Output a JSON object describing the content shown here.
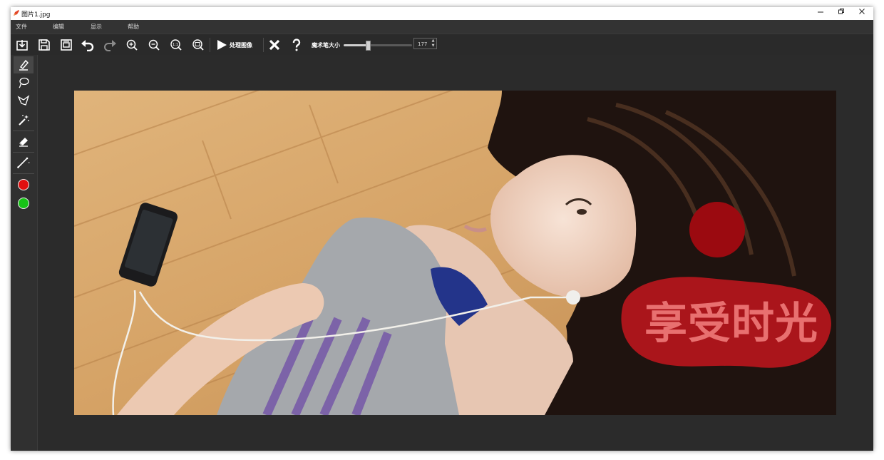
{
  "window": {
    "title": "图片1.jpg",
    "minimize_icon": "minimize-icon",
    "restore_icon": "restore-icon",
    "close_icon": "close-icon"
  },
  "menubar": {
    "items": [
      "文件",
      "编辑",
      "显示",
      "帮助"
    ]
  },
  "toolbar": {
    "process_label": "处理图像",
    "brush_size_label": "魔术笔大小",
    "brush_size_value": "177",
    "brush_size_fraction": 0.35,
    "icons": [
      "import-icon",
      "save-icon",
      "save-as-icon",
      "undo-icon",
      "redo-icon",
      "zoom-in-icon",
      "zoom-out-icon",
      "actual-size-icon",
      "fit-window-icon",
      "play-icon",
      "clear-icon",
      "help-icon"
    ],
    "actual_size_glyph": "1:1"
  },
  "tools": {
    "icons": [
      "marker-icon",
      "lasso-icon",
      "polygon-lasso-icon",
      "magic-wand-icon",
      "eraser-icon",
      "line-icon"
    ],
    "colors": [
      "#e01010",
      "#17c417"
    ]
  },
  "image": {
    "overlay_text": "享受时光",
    "mark_color": "#9b0a10"
  }
}
